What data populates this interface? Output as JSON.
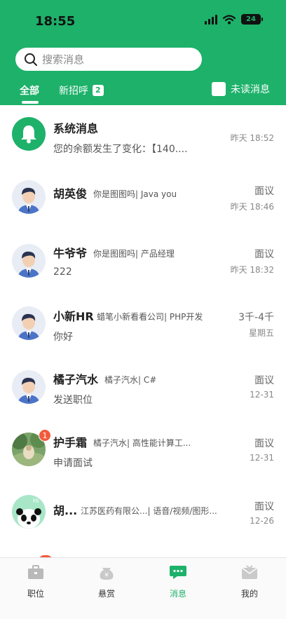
{
  "status_bar": {
    "time": "18:55",
    "battery": "24"
  },
  "search": {
    "placeholder": "搜索消息"
  },
  "tabs": {
    "all": "全部",
    "new_recruit": "新招呼",
    "new_recruit_count": "2",
    "unread_label": "未读消息"
  },
  "messages": [
    {
      "name": "系统消息",
      "meta": "",
      "preview": "您的余额发生了变化：【140....",
      "salary": "",
      "date": "昨天 18:52",
      "avatar": "bell-icon"
    },
    {
      "name": "胡英俊",
      "meta": "你是图图吗| Java you",
      "preview": "",
      "salary": "面议",
      "date": "昨天 18:46",
      "avatar": "man-avatar"
    },
    {
      "name": "牛爷爷",
      "meta": "你是图图吗| 产品经理",
      "preview": "222",
      "salary": "面议",
      "date": "昨天 18:32",
      "avatar": "man-avatar"
    },
    {
      "name": "小新HR",
      "meta": "蜡笔小新看看公司| PHP开发",
      "preview": "你好",
      "salary": "3千-4千",
      "date": "星期五",
      "avatar": "man-avatar"
    },
    {
      "name": "橘子汽水",
      "meta": "橘子汽水| C#",
      "preview": "发送职位",
      "salary": "面议",
      "date": "12-31",
      "avatar": "man-avatar"
    },
    {
      "name": "护手霜",
      "meta": "橘子汽水| 高性能计算工...",
      "preview": "申请面试",
      "salary": "面议",
      "date": "12-31",
      "avatar": "forest-avatar",
      "badge": "1"
    },
    {
      "name": "胡...",
      "meta": "江苏医药有限公...| 语音/视频/图形...",
      "preview": "",
      "salary": "面议",
      "date": "12-26",
      "avatar": "panda-avatar"
    }
  ],
  "tabbar": [
    {
      "label": "职位",
      "icon": "briefcase-icon"
    },
    {
      "label": "悬赏",
      "icon": "coin-bag-icon"
    },
    {
      "label": "消息",
      "icon": "chat-icon"
    },
    {
      "label": "我的",
      "icon": "profile-icon"
    }
  ],
  "colors": {
    "brand": "#1db16a",
    "badge_red": "#f25a3c"
  }
}
